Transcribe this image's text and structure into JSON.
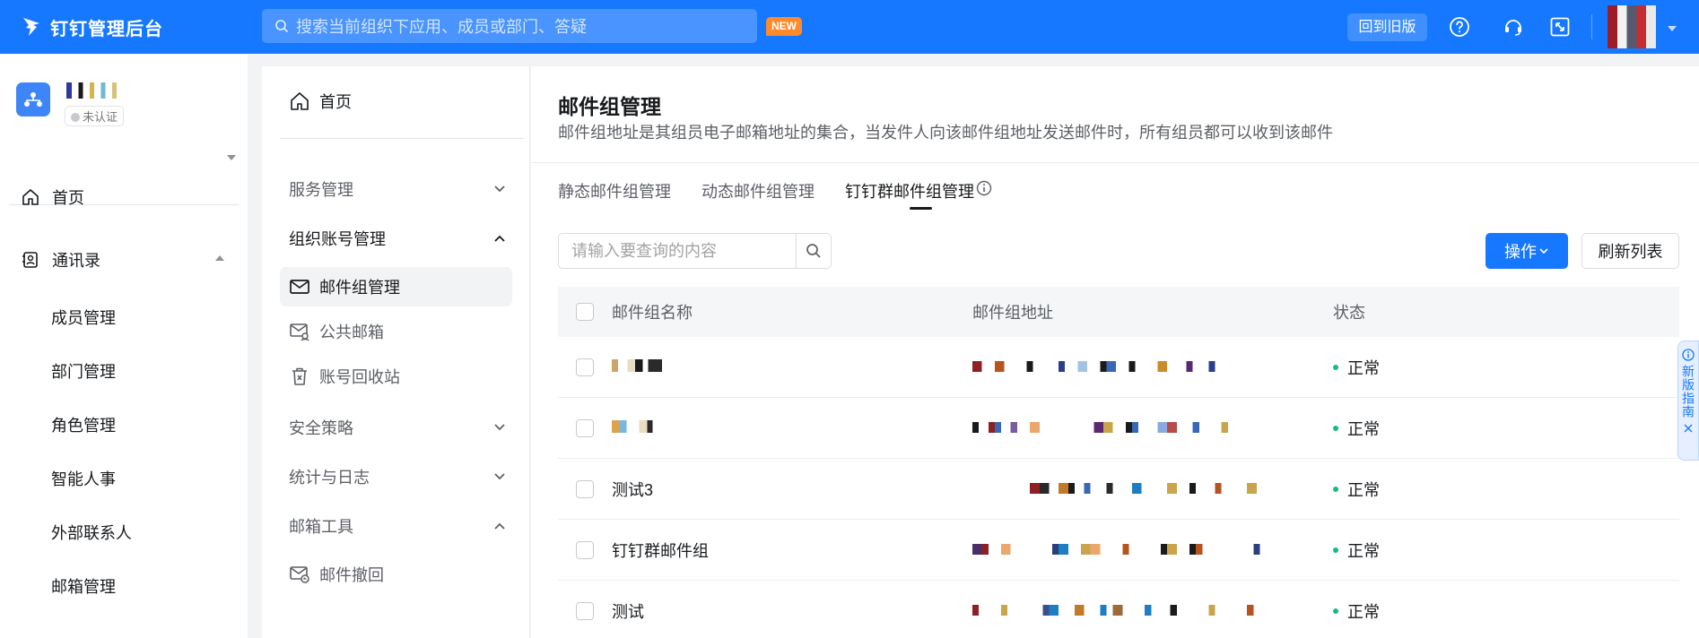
{
  "topbar": {
    "title": "钉钉管理后台",
    "search_placeholder": "搜索当前组织下应用、成员或部门、答疑",
    "new_badge": "NEW",
    "back_label": "回到旧版"
  },
  "org": {
    "status": "未认证"
  },
  "sidebar": {
    "home": "首页",
    "contacts": "通讯录",
    "items": [
      "成员管理",
      "部门管理",
      "角色管理",
      "智能人事",
      "外部联系人",
      "邮箱管理"
    ]
  },
  "midnav": {
    "home": "首页",
    "groups": {
      "service": "服务管理",
      "org_account": "组织账号管理",
      "security": "安全策略",
      "stats": "统计与日志",
      "mail_tools": "邮箱工具"
    },
    "items": {
      "mail_group": "邮件组管理",
      "public_mailbox": "公共邮箱",
      "recycle": "账号回收站",
      "recall": "邮件撤回"
    }
  },
  "main": {
    "title": "邮件组管理",
    "description": "邮件组地址是其组员电子邮箱地址的集合，当发件人向该邮件组地址发送邮件时，所有组员都可以收到该邮件",
    "tabs": [
      "静态邮件组管理",
      "动态邮件组管理",
      "钉钉群邮件组管理"
    ],
    "search_placeholder": "请输入要查询的内容",
    "operate_label": "操作",
    "refresh_label": "刷新列表",
    "columns": [
      "邮件组名称",
      "邮件组地址",
      "状态"
    ],
    "rows": [
      {
        "name": "",
        "status": "正常"
      },
      {
        "name": "",
        "status": "正常"
      },
      {
        "name": "测试3",
        "status": "正常"
      },
      {
        "name": "钉钉群邮件组",
        "status": "正常"
      },
      {
        "name": "测试",
        "status": "正常"
      }
    ]
  },
  "side_guide": {
    "label": "新版指南"
  },
  "colors": {
    "brand": "#1677ff",
    "status_ok": "#15bc83"
  }
}
